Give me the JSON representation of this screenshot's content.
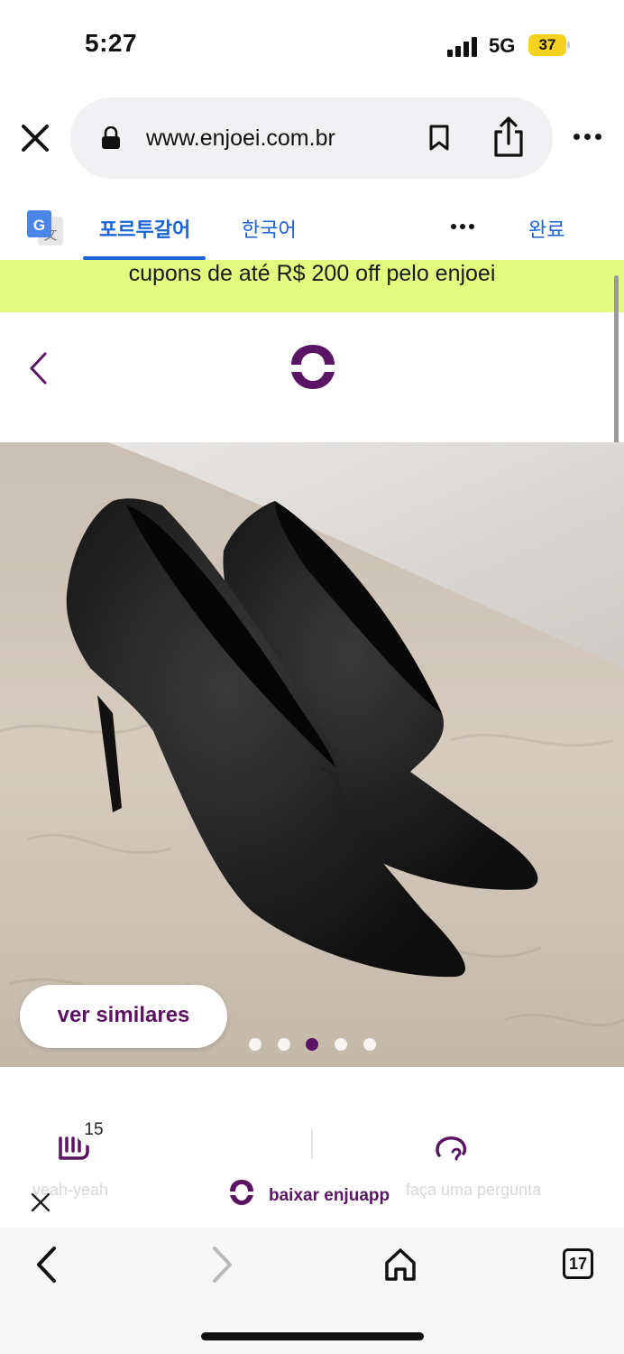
{
  "status_bar": {
    "time": "5:27",
    "network": "5G",
    "battery": "37"
  },
  "browser": {
    "url": "www.enjoei.com.br"
  },
  "translate_bar": {
    "tab_source": "포르투갈어",
    "tab_target": "한국어",
    "done": "완료"
  },
  "promo": {
    "text": "cupons de até R$ 200 off pelo enjoei"
  },
  "product": {
    "similar_button": "ver similares",
    "carousel": {
      "current": 3,
      "total": 5
    }
  },
  "actions": {
    "likes_count": "15",
    "likes_label_faded": "yeah-yeah",
    "ask_label_faded": "faça uma pergunta"
  },
  "app_banner": {
    "label": "baixar enjuapp"
  },
  "toolbar": {
    "tab_count": "17"
  },
  "colors": {
    "brand": "#5a1463",
    "promo_bg": "#e3fb7f",
    "link_blue": "#1a63d6"
  }
}
